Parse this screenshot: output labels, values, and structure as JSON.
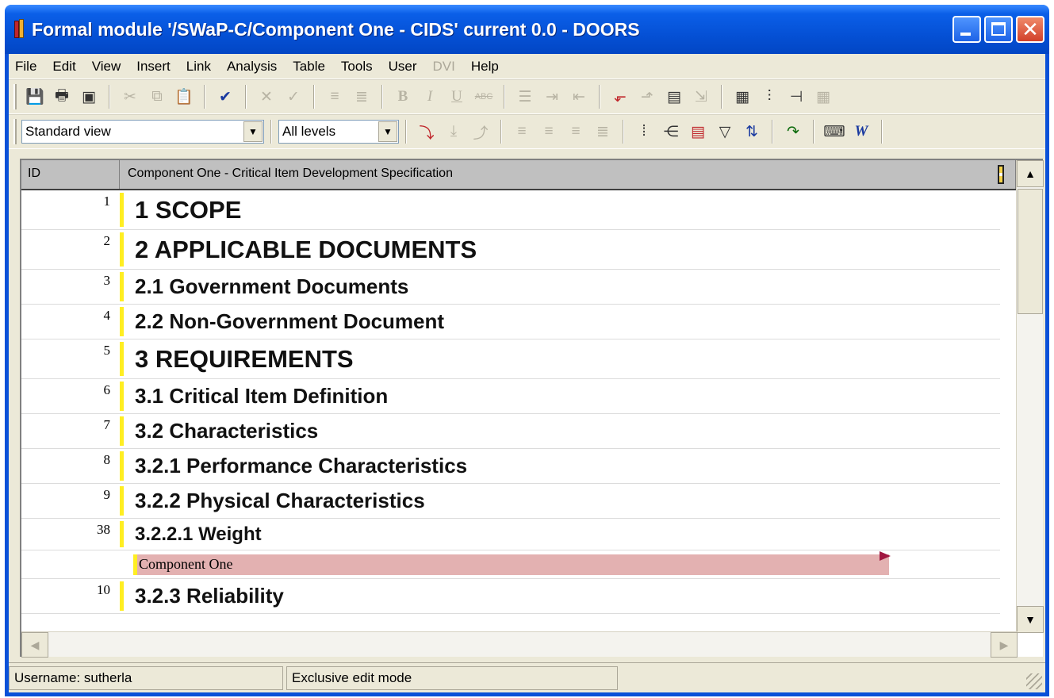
{
  "window": {
    "title": "Formal module '/SWaP-C/Component One - CIDS' current 0.0 - DOORS"
  },
  "menu": [
    "File",
    "Edit",
    "View",
    "Insert",
    "Link",
    "Analysis",
    "Table",
    "Tools",
    "User",
    "DVI",
    "Help"
  ],
  "menu_disabled": [
    "DVI"
  ],
  "toolbar1_icons": [
    "save-icon",
    "print-icon",
    "properties-icon",
    "cut-icon",
    "copy-icon",
    "paste-icon",
    "spellcheck-icon",
    "delete-icon",
    "accept-icon",
    "bullet-indent-icon",
    "bullet-outdent-icon",
    "bold-icon",
    "italic-icon",
    "underline-icon",
    "strikethrough-icon",
    "list-icon",
    "indent-icon",
    "outdent-icon",
    "link-start-icon",
    "link-end-icon",
    "object-properties-icon",
    "link-icon",
    "table-icon",
    "insert-column-icon",
    "split-icon",
    "grid-icon"
  ],
  "toolbar2": {
    "view_select": "Standard view",
    "level_select": "All levels"
  },
  "grid": {
    "columns": [
      "ID",
      "Component One - Critical Item Development Specification"
    ],
    "rows": [
      {
        "id": "1",
        "text": "1 SCOPE",
        "level": 1
      },
      {
        "id": "2",
        "text": "2 APPLICABLE DOCUMENTS",
        "level": 1
      },
      {
        "id": "3",
        "text": "2.1 Government Documents",
        "level": 2
      },
      {
        "id": "4",
        "text": "2.2 Non-Government Document",
        "level": 2
      },
      {
        "id": "5",
        "text": "3 REQUIREMENTS",
        "level": 1
      },
      {
        "id": "6",
        "text": "3.1 Critical Item Definition",
        "level": 2
      },
      {
        "id": "7",
        "text": "3.2 Characteristics",
        "level": 2
      },
      {
        "id": "8",
        "text": "3.2.1 Performance Characteristics",
        "level": 2
      },
      {
        "id": "9",
        "text": "3.2.2 Physical Characteristics",
        "level": 2
      },
      {
        "id": "38",
        "text": "3.2.2.1 Weight",
        "level": 4
      },
      {
        "id": "",
        "text": "Component One",
        "level": 0
      },
      {
        "id": "10",
        "text": "3.2.3 Reliability",
        "level": 2
      }
    ]
  },
  "status": {
    "username": "Username: sutherla",
    "mode": "Exclusive edit mode"
  },
  "colors": {
    "titlebar": "#0551d6",
    "level_bar": "#ffee22",
    "object_highlight": "#e3b1b1"
  }
}
